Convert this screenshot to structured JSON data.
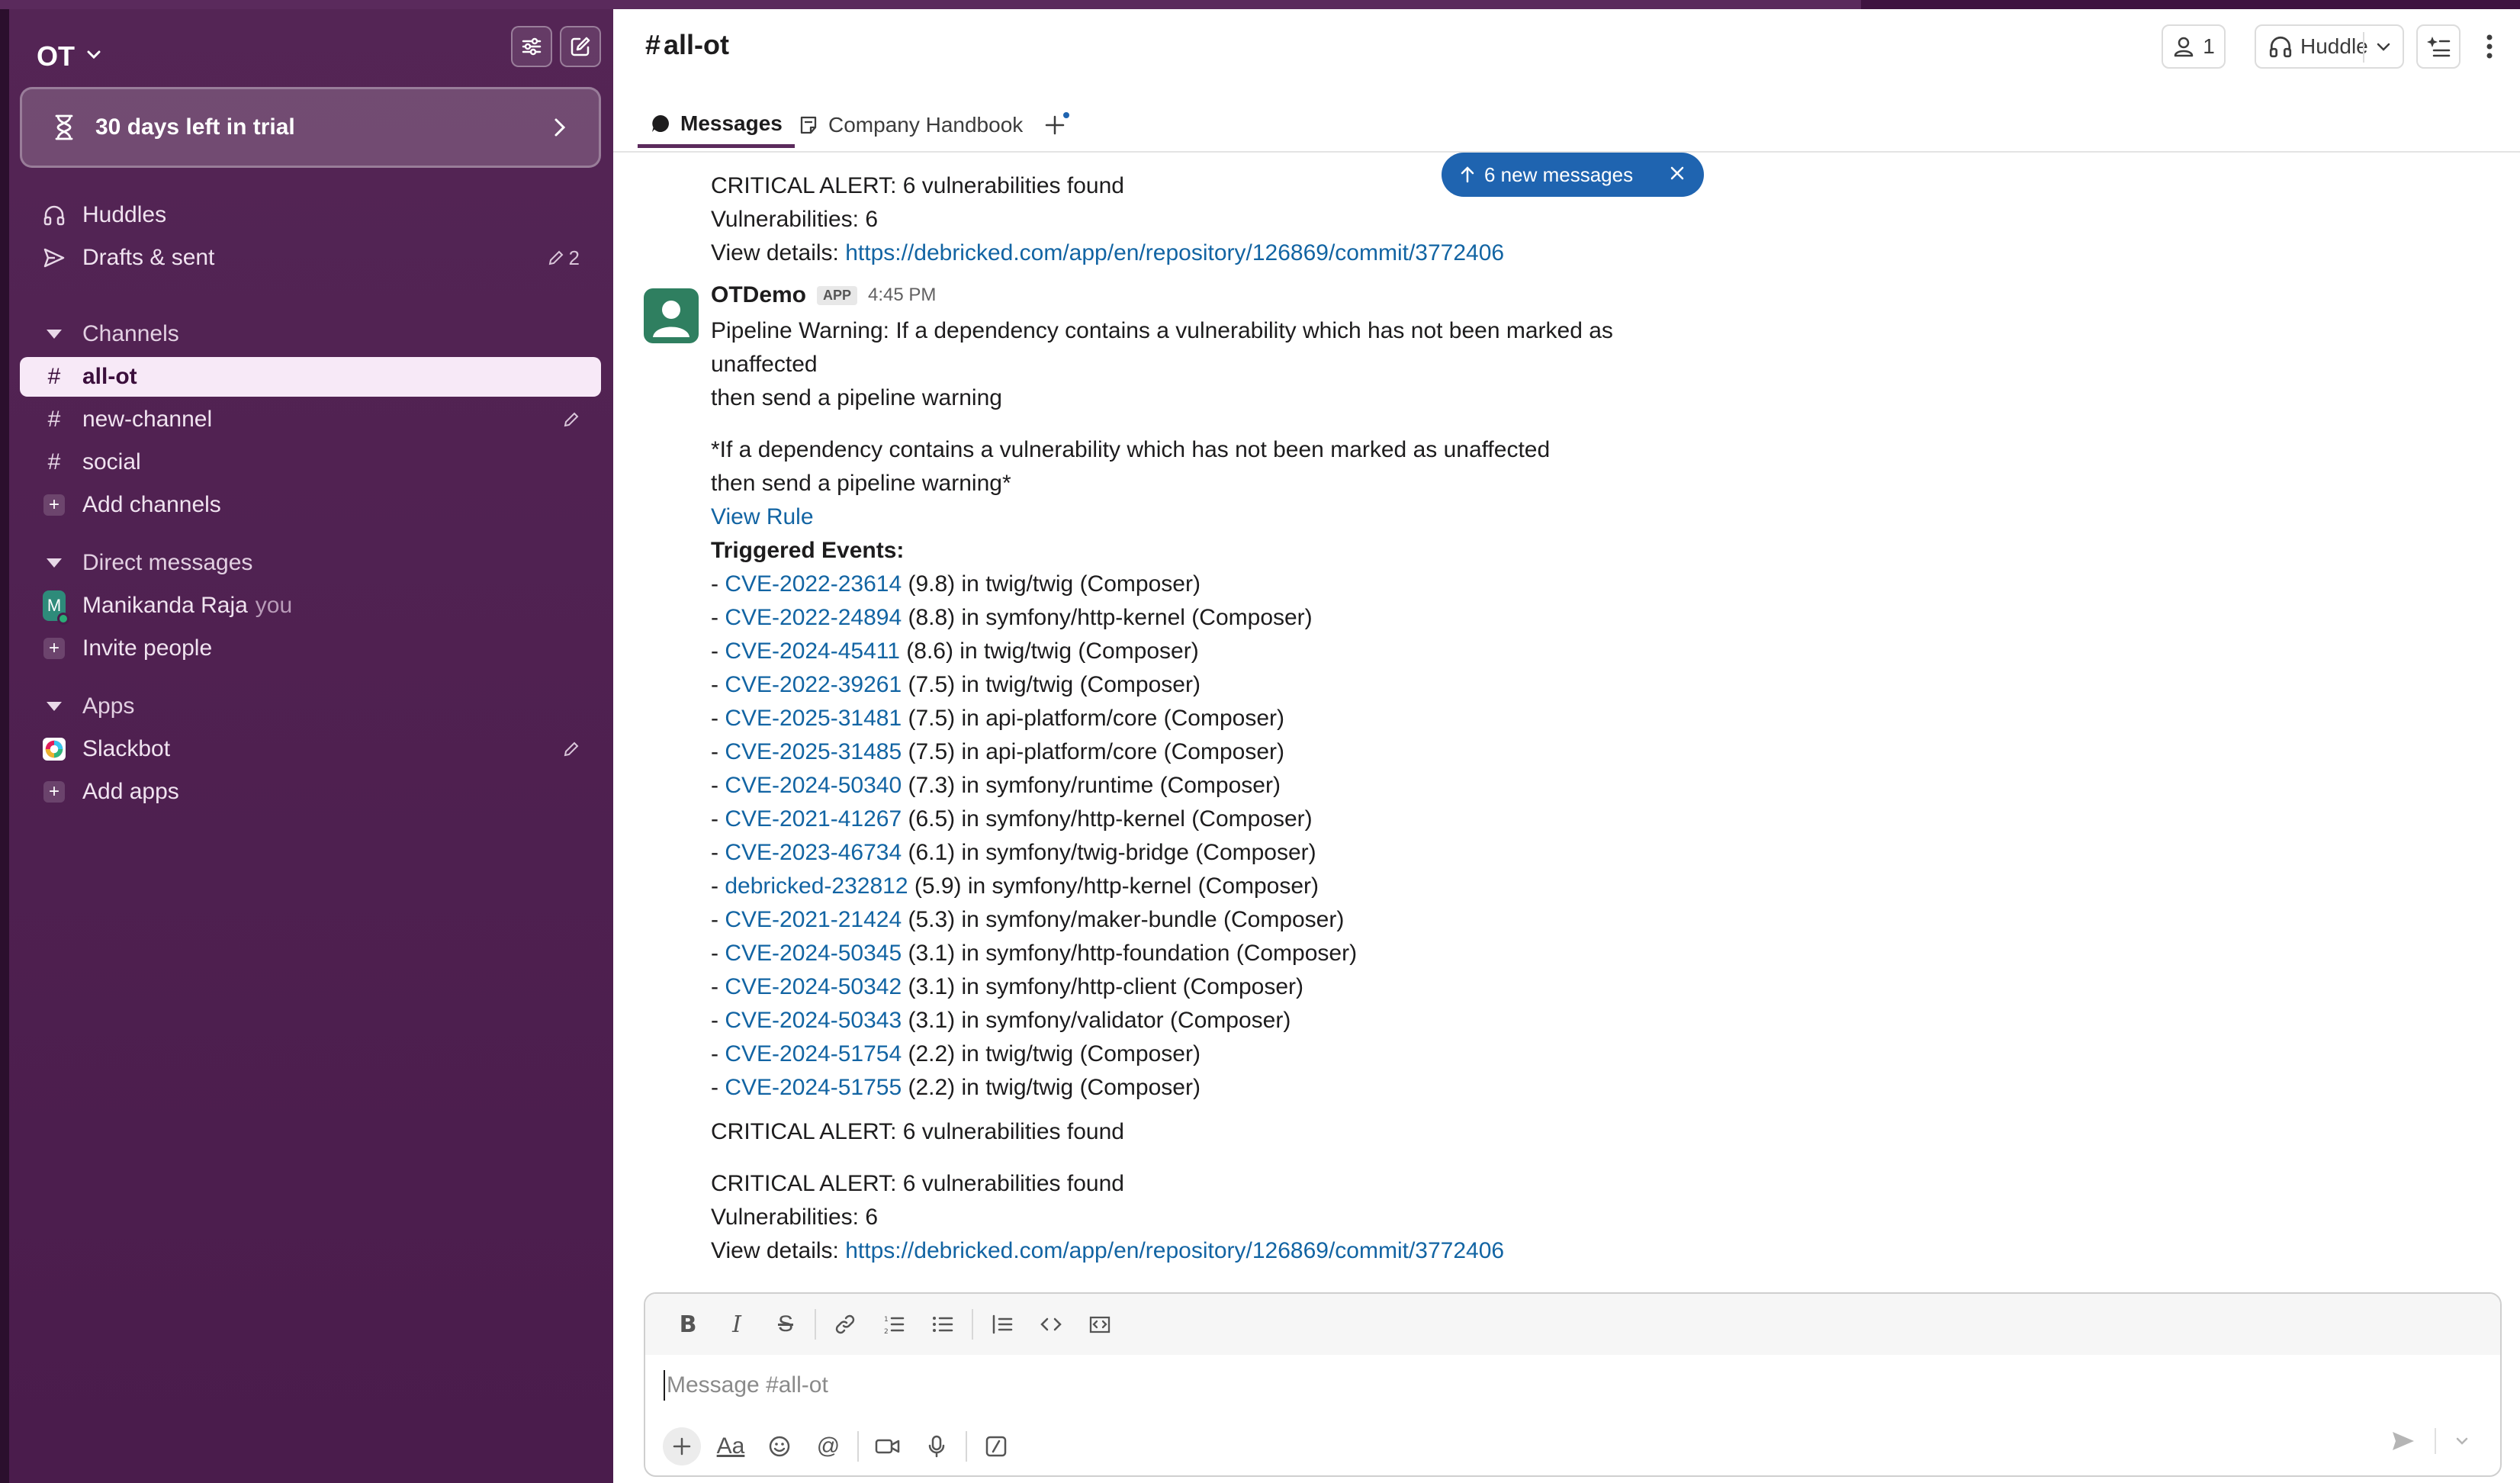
{
  "workspace": {
    "name": "OT"
  },
  "trial": {
    "label": "30 days left in trial"
  },
  "sidebar": {
    "top_items": [
      {
        "label": "Huddles"
      },
      {
        "label": "Drafts & sent",
        "count": "2"
      }
    ],
    "channels_header": "Channels",
    "channels": [
      {
        "label": "all-ot"
      },
      {
        "label": "new-channel"
      },
      {
        "label": "social"
      }
    ],
    "add_channels": "Add channels",
    "dm_header": "Direct messages",
    "dm_user": {
      "initial": "M",
      "name": "Manikanda Raja",
      "suffix": "you"
    },
    "invite": "Invite people",
    "apps_header": "Apps",
    "slackbot": "Slackbot",
    "add_apps": "Add apps"
  },
  "header": {
    "channel": "all-ot",
    "hash": "#",
    "members_count": "1",
    "huddle_label": "Huddle"
  },
  "tabs": [
    {
      "label": "Messages"
    },
    {
      "label": "Company Handbook"
    }
  ],
  "new_messages_pill": "6 new messages",
  "messages": {
    "prev": {
      "alert": "CRITICAL ALERT: 6 vulnerabilities found",
      "count": "Vulnerabilities: 6",
      "details_prefix": "View details: ",
      "details_link": "https://debricked.com/app/en/repository/126869/commit/3772406"
    },
    "main": {
      "sender": "OTDemo",
      "badge": "APP",
      "time": "4:45 PM",
      "warning_1": "Pipeline Warning: If a dependency contains a vulnerability which has not been marked as",
      "warning_2": "unaffected",
      "warning_3": "then send a pipeline warning",
      "rule_1": "*If a dependency contains a vulnerability which has not been marked as unaffected",
      "rule_2": "then send a pipeline warning*",
      "view_rule": "View Rule",
      "triggered": "Triggered Events:",
      "events": [
        {
          "id": "CVE-2022-23614",
          "rest": " (9.8) in twig/twig (Composer)"
        },
        {
          "id": "CVE-2022-24894",
          "rest": " (8.8) in symfony/http-kernel (Composer)"
        },
        {
          "id": "CVE-2024-45411",
          "rest": " (8.6) in twig/twig (Composer)"
        },
        {
          "id": "CVE-2022-39261",
          "rest": " (7.5) in twig/twig (Composer)"
        },
        {
          "id": "CVE-2025-31481",
          "rest": " (7.5) in api-platform/core (Composer)"
        },
        {
          "id": "CVE-2025-31485",
          "rest": " (7.5) in api-platform/core (Composer)"
        },
        {
          "id": "CVE-2024-50340",
          "rest": " (7.3) in symfony/runtime (Composer)"
        },
        {
          "id": "CVE-2021-41267",
          "rest": " (6.5) in symfony/http-kernel (Composer)"
        },
        {
          "id": "CVE-2023-46734",
          "rest": " (6.1) in symfony/twig-bridge (Composer)"
        },
        {
          "id": "debricked-232812",
          "rest": " (5.9) in symfony/http-kernel (Composer)"
        },
        {
          "id": "CVE-2021-21424",
          "rest": " (5.3) in symfony/maker-bundle (Composer)"
        },
        {
          "id": "CVE-2024-50345",
          "rest": " (3.1) in symfony/http-foundation (Composer)"
        },
        {
          "id": "CVE-2024-50342",
          "rest": " (3.1) in symfony/http-client (Composer)"
        },
        {
          "id": "CVE-2024-50343",
          "rest": " (3.1) in symfony/validator (Composer)"
        },
        {
          "id": "CVE-2024-51754",
          "rest": " (2.2) in twig/twig (Composer)"
        },
        {
          "id": "CVE-2024-51755",
          "rest": " (2.2) in twig/twig (Composer)"
        }
      ],
      "alert_a": "CRITICAL ALERT: 6 vulnerabilities found",
      "alert_b": "CRITICAL ALERT: 6 vulnerabilities found",
      "count_b": "Vulnerabilities: 6",
      "details_prefix": "View details: ",
      "details_link": "https://debricked.com/app/en/repository/126869/commit/3772406"
    }
  },
  "composer": {
    "placeholder": "Message #all-ot",
    "format_label": "Aa"
  },
  "colors": {
    "sidebar": "#4a1c4c",
    "link": "#1264a3",
    "pill": "#1f64b0",
    "active_item_bg": "#f7e9f7"
  }
}
